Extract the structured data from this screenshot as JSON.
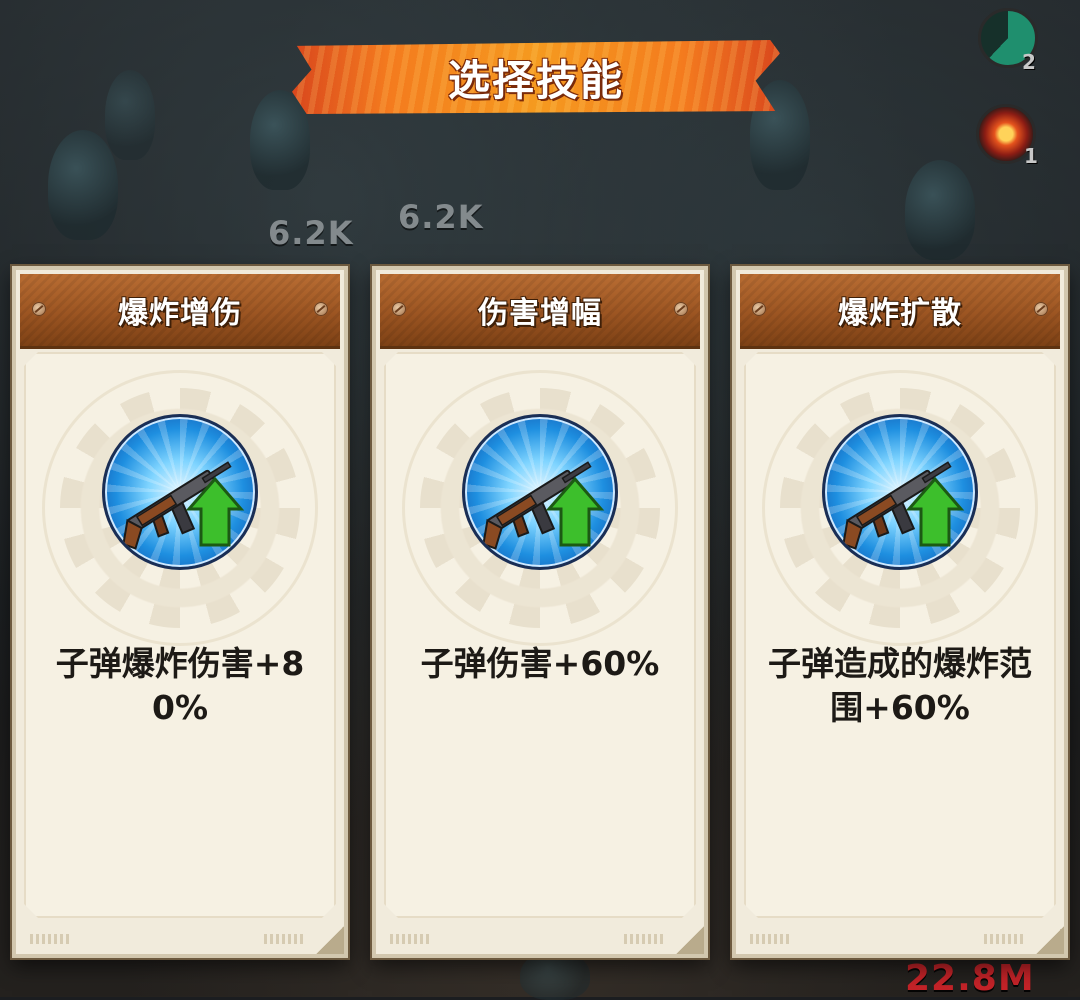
{
  "header": {
    "title": "选择技能"
  },
  "status": {
    "timer": {
      "icon": "cooldown-timer-icon",
      "count": "2"
    },
    "fire": {
      "icon": "fire-shield-icon",
      "count": "1"
    }
  },
  "background": {
    "damage_numbers": [
      "6.2K",
      "6.2K",
      "22.8M"
    ]
  },
  "cards": [
    {
      "title": "爆炸增伤",
      "icon": "assault-rifle-upgrade-icon",
      "description": "子弹爆炸伤害+80%"
    },
    {
      "title": "伤害增幅",
      "icon": "assault-rifle-upgrade-icon",
      "description": "子弹伤害+60%"
    },
    {
      "title": "爆炸扩散",
      "icon": "assault-rifle-upgrade-icon",
      "description": "子弹造成的爆炸范围+60%"
    }
  ],
  "colors": {
    "banner": "#f47b1e",
    "card_header": "#9c5522",
    "card_body": "#f1ebdc",
    "upgrade_arrow": "#3dbf2c"
  }
}
